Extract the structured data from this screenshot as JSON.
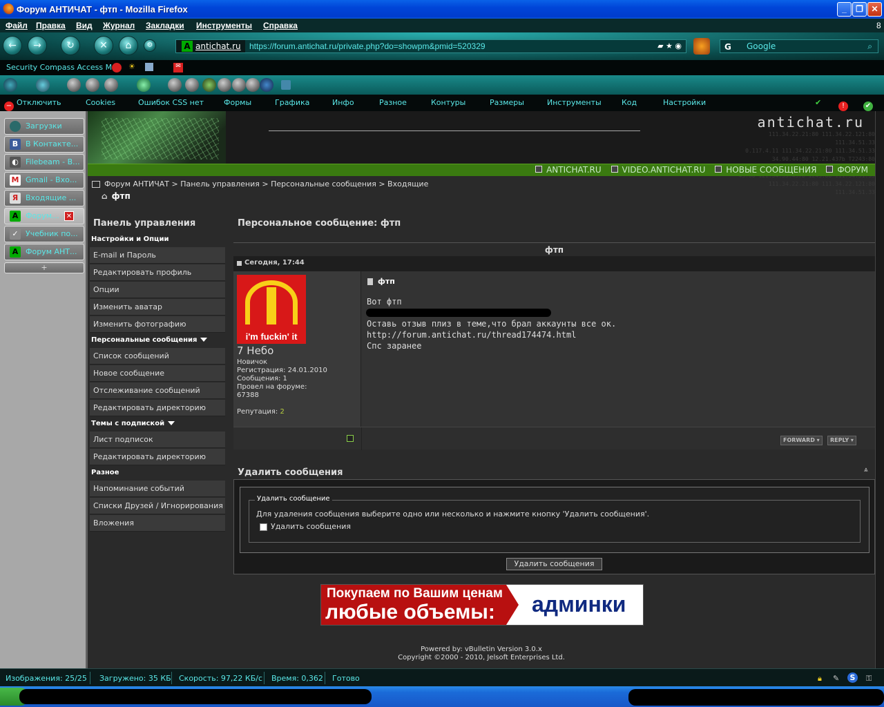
{
  "window": {
    "title": "Форум АНТИЧАТ - фтп - Mozilla Firefox"
  },
  "menu": [
    "Файл",
    "Правка",
    "Вид",
    "Журнал",
    "Закладки",
    "Инструменты",
    "Справка"
  ],
  "menu_right": "8",
  "address": {
    "site": "antichat.ru",
    "url": "https://forum.antichat.ru/private.php?do=showpm&pmid=520329"
  },
  "search": {
    "placeholder": "Google"
  },
  "bookmarks": {
    "item": "Security Compass Access Me"
  },
  "webdev": [
    "Отключить",
    "Cookies",
    "Ошибок CSS нет",
    "Формы",
    "Графика",
    "Инфо",
    "Разное",
    "Контуры",
    "Размеры",
    "Инструменты",
    "Код",
    "Настройки"
  ],
  "sidebar_tabs": [
    "Загрузки",
    "В Контакте...",
    "Filebeam - В...",
    "Gmail - Вхо...",
    "Входящие ...",
    "Форум...",
    "Учебник по...",
    "Форум АНТ..."
  ],
  "page": {
    "logo": "antichat.ru",
    "banner_nums": [
      "111.34.22.21:80  111.34.22.121:80  111.34.51.33",
      "0.117.4.11   111.34.22.21:80  111.34.51.33",
      "34.90.44:80  12.21.437b  T2243:80  T17.97.7b.80",
      "43:80  121.54.33.437b  1243:80 111.34.51.33",
      "111.34.22.21:80  111.34.22.121:80  111.34.51.33"
    ],
    "toplinks": [
      "ANTICHAT.RU",
      "VIDEO.ANTICHAT.RU",
      "НОВЫЕ СООБЩЕНИЯ",
      "ФОРУМ"
    ],
    "breadcrumb": "Форум АНТИЧАТ > Панель управления > Персональные сообщения > Входящие",
    "subtitle": "фтп",
    "cp_title": "Панель управления",
    "pm_title": "Персональное сообщение: фтп",
    "sections": {
      "settings": "Настройки и Опции",
      "settings_items": [
        "E-mail и Пароль",
        "Редактировать профиль",
        "Опции",
        "Изменить аватар",
        "Изменить фотографию"
      ],
      "pm": "Персональные сообщения",
      "pm_items": [
        "Список сообщений",
        "Новое сообщение",
        "Отслеживание сообщений",
        "Редактировать директорию"
      ],
      "subs": "Темы с подпиской",
      "subs_items": [
        "Лист подписок",
        "Редактировать директорию"
      ],
      "misc": "Разное",
      "misc_items": [
        "Напоминание событий",
        "Списки Друзей / Игнорирования",
        "Вложения"
      ]
    },
    "message": {
      "header": "фтп",
      "date": "Сегодня, 17:44",
      "avatar_caption": "i'm fuckin' it",
      "user": "7 Небо",
      "rank": "Новичок",
      "reg": "Регистрация: 24.01.2010",
      "posts": "Сообщения: 1",
      "time_label": "Провел на форуме:",
      "time_value": "67388",
      "rep_label": "Репутация:",
      "rep_value": "2",
      "title": "фтп",
      "lines": [
        "Вот фтп",
        "Оставь отзыв плиз в теме,что брал аккаунты все ок.",
        "http://forum.antichat.ru/thread174474.html",
        "Спс заранее"
      ],
      "forward": "FORWARD",
      "reply": "REPLY"
    },
    "delete": {
      "title": "Удалить сообщения",
      "legend": "Удалить сообщение",
      "text": "Для удаления сообщения выберите одно или несколько и нажмите кнопку 'Удалить сообщения'.",
      "checkbox": "Удалить сообщения",
      "button": "Удалить сообщения"
    },
    "ad": {
      "line1": "Покупаем по Вашим ценам",
      "line2": "любые объемы:",
      "right": "админки"
    },
    "powered": "Powered by: vBulletin Version 3.0.x",
    "copyright": "Copyright ©2000 - 2010, Jelsoft Enterprises Ltd."
  },
  "status": {
    "images": "Изображения: 25/25",
    "loaded": "Загружено: 35 КБ",
    "speed": "Скорость: 97,22 КБ/с",
    "time": "Время: 0,362",
    "done": "Готово"
  }
}
